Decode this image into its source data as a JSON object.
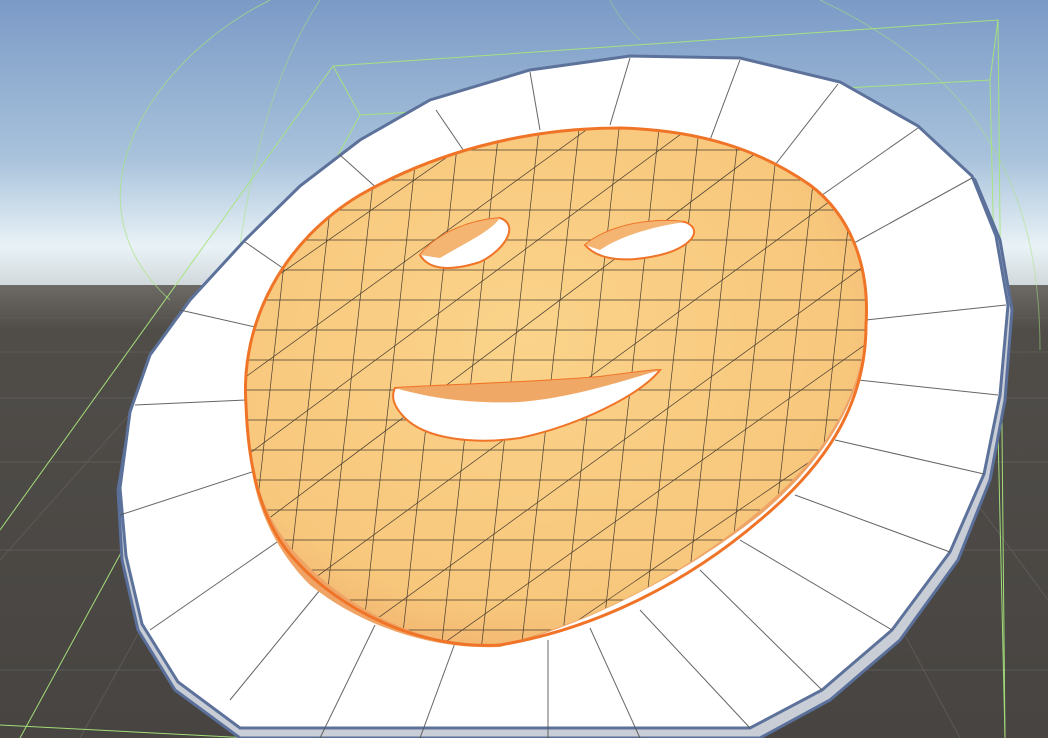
{
  "viewport": {
    "view": "scene-view",
    "mode": "shaded-wireframe",
    "selected_object": "smiley-face-mesh"
  },
  "colors": {
    "sky_top": "#7d9cc8",
    "sky_horizon": "#e8f1f5",
    "ground": "#4c4946",
    "grid_line": "#5d5a57",
    "plate_face": "#ffffff",
    "plate_rim": "#c2c7cf",
    "plate_outline": "#5a6f9a",
    "mesh_fill": "#f8cc80",
    "mesh_shade": "#f0a968",
    "selection_outline": "#f07428",
    "wireframe": "#2a2520",
    "gizmo_green": "#a6e67a"
  },
  "icons": {
    "selection": "selection-outline-icon",
    "bounds": "bounding-box-gizmo-icon"
  }
}
